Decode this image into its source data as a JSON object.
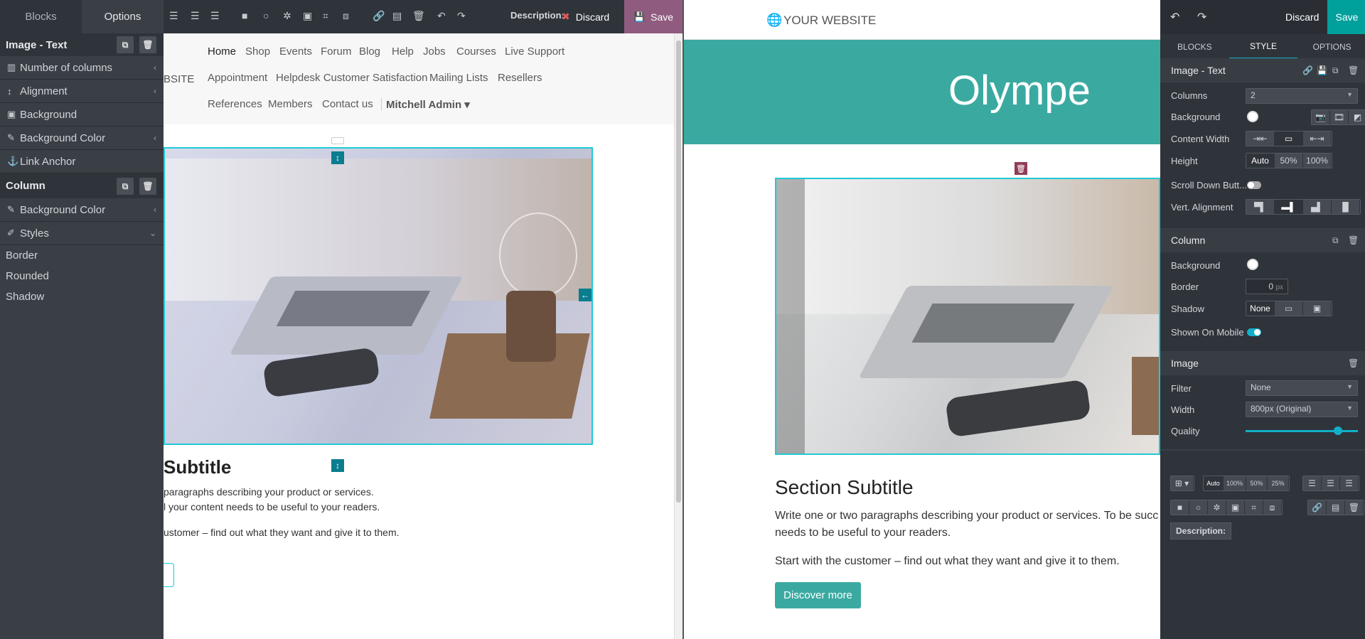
{
  "left_editor": {
    "tabs": [
      "Blocks",
      "Options"
    ],
    "active_tab": "Options",
    "sections": {
      "image_text_title": "Image - Text",
      "image_text_rows": [
        "Number of columns",
        "Alignment",
        "Background",
        "Background Color",
        "Link Anchor"
      ],
      "column_title": "Column",
      "column_rows": [
        "Background Color",
        "Styles"
      ],
      "styles_subitems": [
        "Border",
        "Rounded",
        "Shadow"
      ]
    },
    "toolbar": {
      "description_label": "Description:",
      "discard_label": "Discard",
      "save_label": "Save"
    },
    "nav": {
      "row1": [
        "Home",
        "Shop",
        "Events",
        "Forum",
        "Blog",
        "Help",
        "Jobs",
        "Courses",
        "Live Support"
      ],
      "row2": [
        "Appointment",
        "Helpdesk Customer Satisfaction",
        "Mailing Lists",
        "Resellers"
      ],
      "row3": [
        "References",
        "Members",
        "Contact us"
      ],
      "user": "Mitchell Admin",
      "logo_fragment": "BSITE"
    },
    "content": {
      "subtitle": "Subtitle",
      "para1": "paragraphs describing your product or services.",
      "para2": "l your content needs to be useful to your readers.",
      "para3": "ustomer – find out what they want and give it to them."
    }
  },
  "right_preview": {
    "site_name": "YOUR WEBSITE",
    "hero_title": "Olympe",
    "section_subtitle": "Section Subtitle",
    "para1": "Write one or two paragraphs describing your product or services. To be succ",
    "para1b": "needs to be useful to your readers.",
    "para2": "Start with the customer – find out what they want and give it to them.",
    "button_label": "Discover more"
  },
  "right_panel": {
    "discard_label": "Discard",
    "save_label": "Save",
    "tabs": [
      "BLOCKS",
      "STYLE",
      "OPTIONS"
    ],
    "active_tab": "STYLE",
    "image_text": {
      "title": "Image - Text",
      "columns_label": "Columns",
      "columns_value": "2",
      "background_label": "Background",
      "content_width_label": "Content Width",
      "height_label": "Height",
      "height_options": [
        "Auto",
        "50%",
        "100%"
      ],
      "scroll_down_label": "Scroll Down Butt...",
      "vert_alignment_label": "Vert. Alignment"
    },
    "column": {
      "title": "Column",
      "background_label": "Background",
      "border_label": "Border",
      "border_value": "0",
      "border_unit": "px",
      "shadow_label": "Shadow",
      "shadow_none": "None",
      "shown_mobile_label": "Shown On Mobile"
    },
    "image": {
      "title": "Image",
      "filter_label": "Filter",
      "filter_value": "None",
      "width_label": "Width",
      "width_value": "800px (Original)",
      "quality_label": "Quality",
      "quality_value": 0.82
    },
    "bottom_toolbar": {
      "size_options": [
        "Auto",
        "100%",
        "50%",
        "25%"
      ],
      "description_label": "Description:"
    },
    "colors": {
      "teal": "#3aaaa1",
      "accent": "#11b0c8",
      "save_bg": "#00a09d"
    }
  }
}
